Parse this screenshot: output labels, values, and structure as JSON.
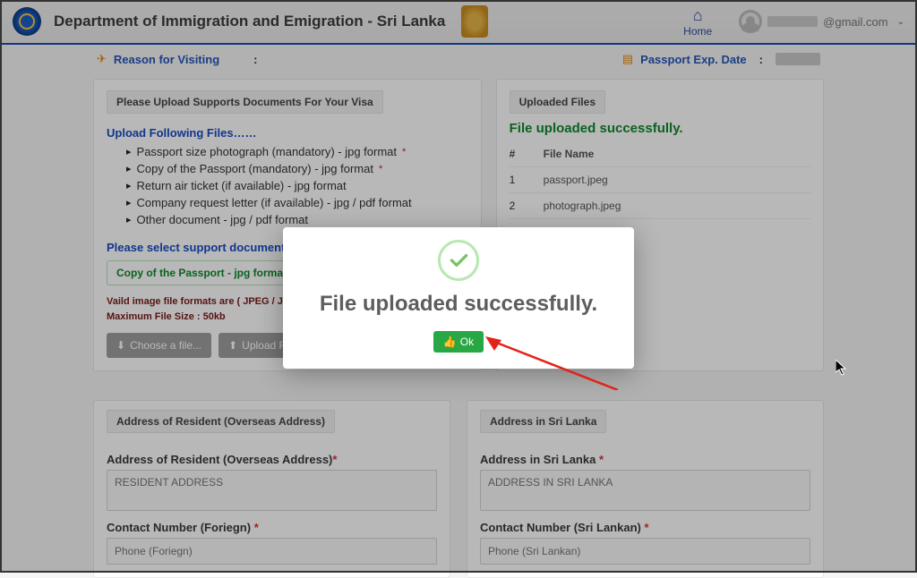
{
  "header": {
    "title": "Department of Immigration and Emigration - Sri Lanka",
    "home_label": "Home",
    "email_suffix": "@gmail.com"
  },
  "top_fields": {
    "reason_label": "Reason for Visiting",
    "exp_label": "Passport Exp. Date"
  },
  "upload": {
    "panel_title": "Please Upload Supports Documents For Your Visa",
    "section_label": "Upload Following Files……",
    "items": [
      "Passport size photograph (mandatory) - jpg format",
      "Copy of the Passport (mandatory) - jpg format",
      "Return air ticket (if available) - jpg format",
      "Company request letter (if available) - jpg / pdf format",
      "Other document - jpg / pdf format"
    ],
    "select_label": "Please select support document from list",
    "doc_button": "Copy of the Passport - jpg format",
    "warn1": "Vaild image file formats are ( JPEG / JPG )",
    "warn2": "Maximum File Size : 50kb",
    "choose_btn": "Choose a file...",
    "upload_btn": "Upload File."
  },
  "uploaded": {
    "panel_title": "Uploaded Files",
    "success_msg": "File uploaded successfully.",
    "col_num": "#",
    "col_name": "File Name",
    "rows": [
      {
        "n": "1",
        "name": "passport.jpeg"
      },
      {
        "n": "2",
        "name": "photograph.jpeg"
      }
    ]
  },
  "addr": {
    "overseas_title": "Address of Resident (Overseas Address)",
    "overseas_field": "Address of Resident (Overseas Address)",
    "overseas_ph": "RESIDENT ADDRESS",
    "overseas_phone_lbl": "Contact Number (Foriegn)",
    "overseas_phone_ph": "Phone (Foriegn)",
    "sl_title": "Address in Sri Lanka",
    "sl_field": "Address in Sri Lanka",
    "sl_ph": "ADDRESS IN SRI LANKA",
    "sl_phone_lbl": "Contact Number (Sri Lankan)",
    "sl_phone_ph": "Phone (Sri Lankan)"
  },
  "modal": {
    "msg": "File uploaded successfully.",
    "ok": "Ok"
  }
}
